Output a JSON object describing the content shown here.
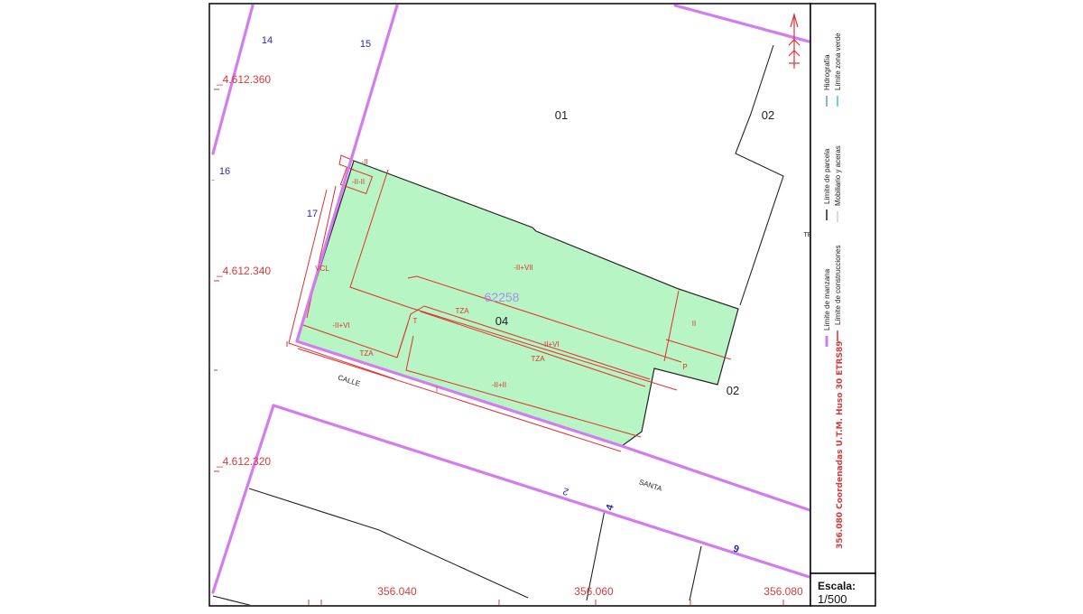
{
  "parcel_id": "62258",
  "sub_parcel": "04",
  "neighbor_parcels": [
    "01",
    "02",
    "02"
  ],
  "block_numbers": [
    "14",
    "15",
    "16",
    "17",
    "2",
    "4",
    "6"
  ],
  "construction_codes": [
    "-II",
    "-II-II",
    "-II+VII",
    "TZA",
    "T",
    "-II+VI",
    "TZA",
    "-II+VI",
    "TZA",
    "-II+II",
    "II",
    "P",
    "VCL",
    "I"
  ],
  "street_labels": [
    "CALLE",
    "SANTA",
    "TE"
  ],
  "coord_y": [
    "_4.612.360",
    "_4.612.340",
    "_4.612.320"
  ],
  "coord_x": [
    "356.040",
    "356.060",
    "356.080"
  ],
  "legend": {
    "title": "356.080 Coordenadas U.T.M. Huso 30 ETRS89",
    "items": [
      "Límite de manzana",
      "Límite de construcciones",
      "Límite de parcela",
      "Mobiliario y aceras",
      "Hidrografía",
      "Límite zona verde"
    ]
  },
  "scale": {
    "label": "Escala:",
    "value": "1/500"
  },
  "colors": {
    "block": "#d27cf0",
    "construction": "#e03030",
    "parcel_fill": "#b8f5c4",
    "parcel_line": "#222222",
    "hydro": "#5a9ad8",
    "green_zone": "#38c9c9",
    "coord": "#d63a3a",
    "block_number": "#2a2aa8"
  }
}
